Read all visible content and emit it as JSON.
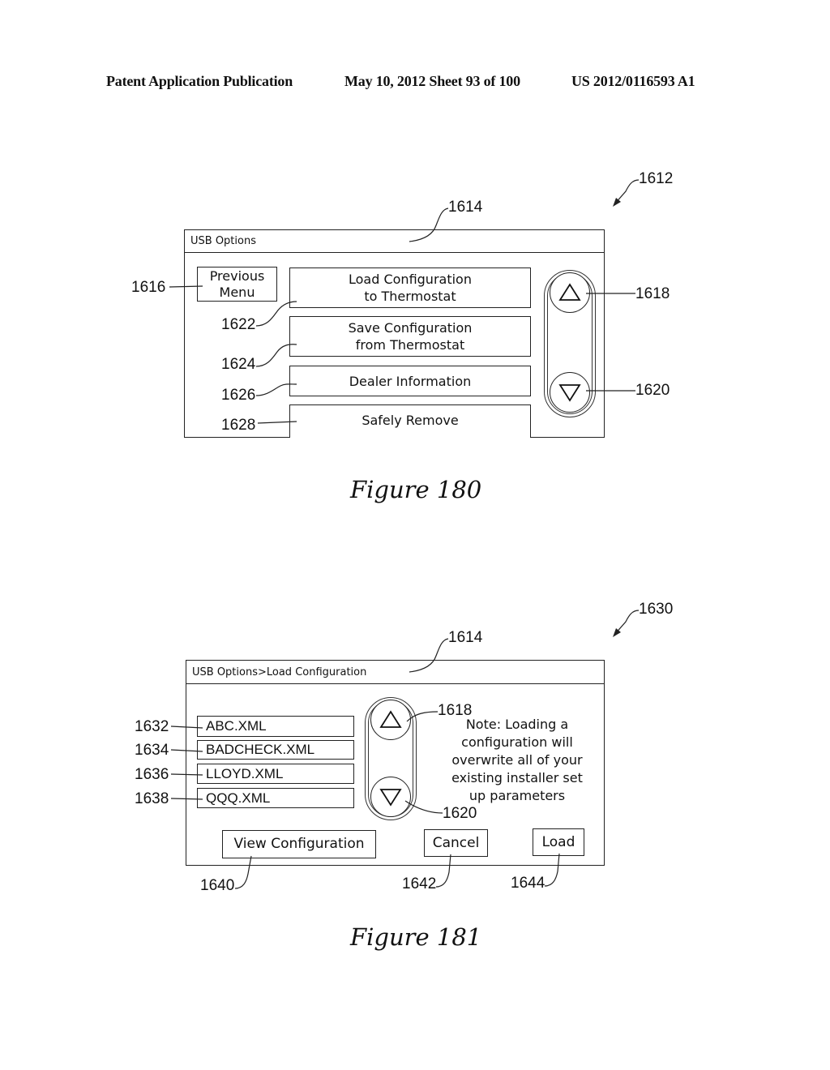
{
  "header": {
    "publication": "Patent Application Publication",
    "date_sheet": "May 10, 2012  Sheet 93 of 100",
    "patent_number": "US 2012/0116593 A1"
  },
  "figure180": {
    "ref_figure": "1612",
    "ref_titlebar": "1614",
    "title": "USB Options",
    "previous_menu": {
      "ref": "1616",
      "line1": "Previous",
      "line2": "Menu"
    },
    "menu_items": [
      {
        "ref": "1622",
        "line1": "Load Configuration",
        "line2": "to Thermostat"
      },
      {
        "ref": "1624",
        "line1": "Save Configuration",
        "line2": "from Thermostat"
      },
      {
        "ref": "1626",
        "line1": "Dealer Information",
        "line2": ""
      },
      {
        "ref": "1628",
        "line1": "Safely Remove",
        "line2": ""
      }
    ],
    "scroll_up": {
      "ref": "1618",
      "icon": "triangle-up-icon"
    },
    "scroll_down": {
      "ref": "1620",
      "icon": "triangle-down-icon"
    },
    "caption": "Figure 180"
  },
  "figure181": {
    "ref_figure": "1630",
    "ref_titlebar": "1614",
    "title": "USB Options>Load Configuration",
    "files": [
      {
        "ref": "1632",
        "name": "ABC.XML"
      },
      {
        "ref": "1634",
        "name": "BADCHECK.XML"
      },
      {
        "ref": "1636",
        "name": "LLOYD.XML"
      },
      {
        "ref": "1638",
        "name": "QQQ.XML"
      }
    ],
    "scroll_up": {
      "ref": "1618",
      "icon": "triangle-up-icon"
    },
    "scroll_down": {
      "ref": "1620",
      "icon": "triangle-down-icon"
    },
    "note_lines": [
      "Note: Loading a",
      "configuration will",
      "overwrite all of your",
      "existing installer set",
      "up parameters"
    ],
    "buttons": {
      "view": {
        "ref": "1640",
        "label": "View Configuration"
      },
      "cancel": {
        "ref": "1642",
        "label": "Cancel"
      },
      "load": {
        "ref": "1644",
        "label": "Load"
      }
    },
    "caption": "Figure 181"
  }
}
